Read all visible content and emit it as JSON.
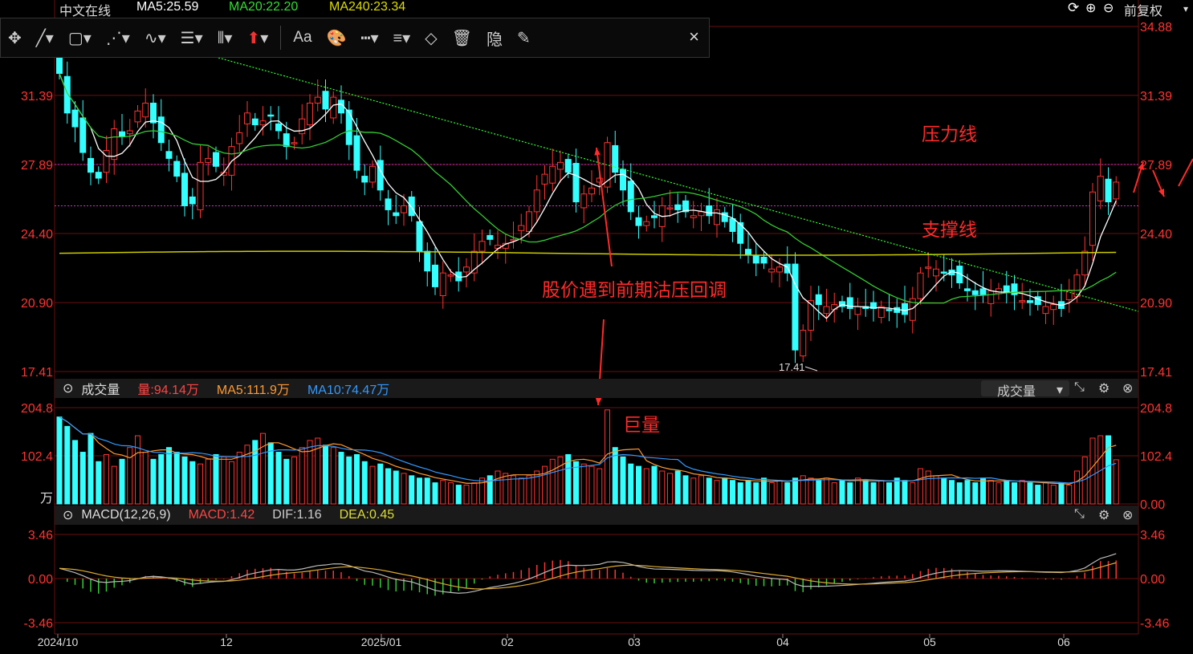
{
  "header": {
    "stock_name": "中文在线",
    "ma5": "MA5:25.59",
    "ma20": "MA20:22.20",
    "ma240": "MA240:23.34",
    "adjust_label": "前复权",
    "colors": {
      "name": "#ffcc00",
      "ma5": "#ffffff",
      "ma20": "#33dd33",
      "ma240": "#dddd00"
    }
  },
  "toolbar": {
    "icons": [
      "crosshair-icon",
      "line-draw-icon",
      "rectangle-icon",
      "polyline-icon",
      "wave-icon",
      "fib-icon",
      "channel-icon",
      "arrow-up-icon",
      "text-icon",
      "palette-icon",
      "line-style-icon",
      "line-width-icon",
      "eraser-icon",
      "trash-icon",
      "hide-icon",
      "pen-icon"
    ],
    "text_label": "Aa",
    "hide_label": "隐",
    "close": "×"
  },
  "volume_bar": {
    "title": "成交量",
    "vol": "量:94.14万",
    "ma5": "MA5:111.9万",
    "ma10": "MA10:74.47万",
    "selector": "成交量"
  },
  "macd_bar": {
    "title": "MACD(12,26,9)",
    "macd": "MACD:1.42",
    "dif": "DIF:1.16",
    "dea": "DEA:0.45"
  },
  "annotations": {
    "pressure": "压力线",
    "support": "支撑线",
    "pullback": "股价遇到前期沽压回调",
    "huge_volume": "巨量"
  },
  "chart_data": [
    {
      "type": "candlestick",
      "name": "price",
      "y_ticks": [
        "34.88",
        "31.39",
        "27.89",
        "24.40",
        "20.90",
        "17.41"
      ],
      "ylim": [
        17.41,
        34.88
      ],
      "low_label": "17.41",
      "x_ticks": [
        "2024/10",
        "12",
        "2025/01",
        "02",
        "03",
        "04",
        "05",
        "06"
      ],
      "ohlc_close": [
        32.5,
        30.5,
        29.8,
        28.5,
        27.5,
        27.2,
        28.6,
        29.7,
        29.3,
        29.6,
        30.6,
        31.0,
        30.0,
        29.0,
        28.2,
        27.3,
        25.8,
        25.9,
        28.0,
        28.2,
        27.8,
        27.5,
        28.8,
        29.5,
        30.5,
        29.9,
        30.1,
        30.4,
        29.6,
        28.8,
        29.0,
        30.2,
        31.0,
        31.3,
        30.7,
        31.3,
        30.5,
        28.9,
        27.6,
        27.0,
        27.8,
        26.6,
        25.6,
        25.3,
        25.8,
        25.3,
        23.5,
        22.5,
        21.7,
        22.4,
        22.3,
        22.0,
        22.7,
        23.5,
        24.0,
        24.1,
        23.8,
        23.9,
        24.1,
        24.8,
        25.5,
        26.6,
        27.4,
        27.8,
        28.0,
        27.5,
        26.0,
        26.4,
        26.7,
        27.2,
        29.0,
        27.5,
        26.6,
        25.5,
        24.8,
        25.0,
        25.2,
        25.8,
        25.7,
        25.6,
        25.5,
        25.3,
        25.5,
        25.3,
        25.6,
        25.0,
        24.5,
        23.9,
        23.3,
        22.9,
        22.9,
        22.6,
        22.7,
        22.4,
        18.5,
        19.5,
        21.0,
        20.8,
        20.7,
        20.8,
        20.7,
        20.6,
        20.7,
        20.6,
        20.6,
        20.7,
        20.5,
        20.4,
        20.3,
        21.1,
        22.4,
        22.7,
        22.6,
        22.4,
        22.3,
        21.9,
        21.5,
        21.3,
        21.3,
        21.5,
        21.6,
        21.4,
        21.3,
        21.0,
        20.9,
        20.8,
        20.7,
        20.8,
        20.6,
        21.5,
        22.3,
        23.5,
        26.5,
        27.3,
        26.0,
        27.0
      ],
      "ma_colors": {
        "ma5": "#ffffff",
        "ma20": "#33cc33",
        "ma240": "#cccc00"
      },
      "support_line": 25.8,
      "pressure_line": 27.89
    },
    {
      "type": "bar",
      "name": "volume",
      "unit": "万",
      "y_ticks": [
        "204.8",
        "102.4",
        "0.00"
      ],
      "ylim": [
        0,
        204.8
      ],
      "values": [
        185,
        165,
        135,
        110,
        150,
        90,
        105,
        80,
        95,
        120,
        145,
        110,
        95,
        105,
        120,
        110,
        100,
        90,
        85,
        95,
        105,
        100,
        90,
        110,
        125,
        135,
        150,
        130,
        110,
        95,
        100,
        120,
        135,
        140,
        125,
        120,
        110,
        100,
        105,
        90,
        80,
        85,
        75,
        70,
        65,
        60,
        55,
        55,
        45,
        50,
        45,
        40,
        40,
        45,
        55,
        60,
        70,
        65,
        60,
        55,
        60,
        70,
        80,
        95,
        100,
        105,
        90,
        85,
        80,
        75,
        200,
        120,
        100,
        85,
        80,
        75,
        80,
        70,
        65,
        70,
        60,
        55,
        60,
        55,
        50,
        55,
        50,
        45,
        50,
        45,
        55,
        45,
        50,
        45,
        55,
        60,
        55,
        50,
        55,
        45,
        50,
        45,
        55,
        50,
        45,
        50,
        45,
        55,
        50,
        45,
        75,
        70,
        60,
        55,
        50,
        45,
        50,
        45,
        55,
        50,
        45,
        50,
        45,
        50,
        45,
        40,
        45,
        40,
        45,
        40,
        70,
        100,
        140,
        145,
        145,
        94
      ]
    },
    {
      "type": "bar",
      "name": "macd",
      "y_ticks": [
        "3.46",
        "0.00",
        "-3.46"
      ],
      "ylim": [
        -3.46,
        3.46
      ]
    }
  ]
}
